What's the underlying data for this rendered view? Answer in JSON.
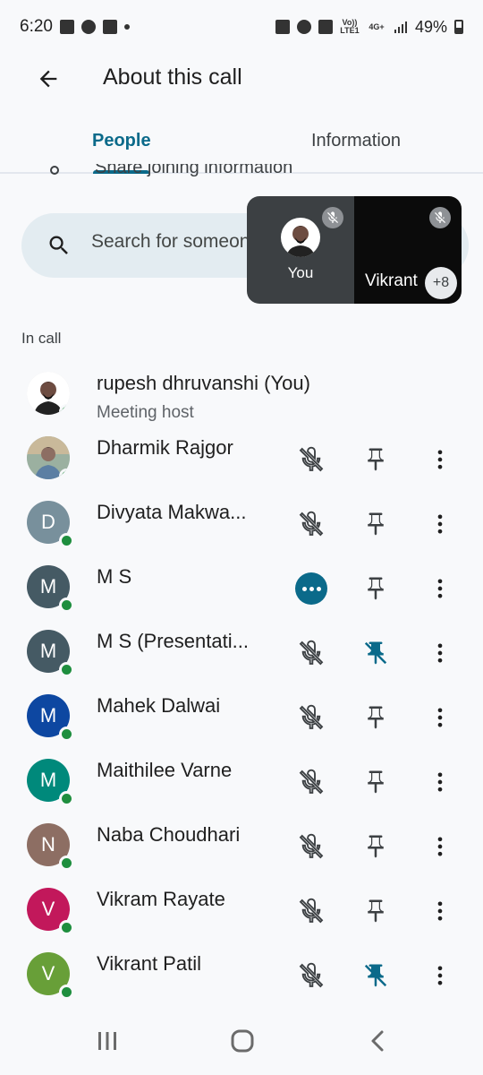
{
  "status_bar": {
    "time": "6:20",
    "battery": "49%",
    "left_icons": [
      "gallery-icon",
      "whatsapp-icon",
      "outlook-icon"
    ],
    "right_icons": [
      "screenshot-icon",
      "alarm-icon",
      "mute-icon",
      "volte-icon",
      "4g-icon",
      "signal-icon"
    ],
    "volte_label": "Vo)) LTE1",
    "network_label": "4G+"
  },
  "app_bar": {
    "title": "About this call"
  },
  "tabs": [
    {
      "label": "People",
      "active": true
    },
    {
      "label": "Information",
      "active": false
    }
  ],
  "partial_row": {
    "text": "Share joining information"
  },
  "search": {
    "placeholder": "Search for someone"
  },
  "video_tile": {
    "self_label": "You",
    "other_label": "Vikrant",
    "more_count": "+8"
  },
  "section": {
    "in_call_label": "In call"
  },
  "participants": [
    {
      "name": "rupesh dhruvanshi (You)",
      "subtitle": "Meeting host",
      "initial": "",
      "avatar_color": "",
      "photo": true,
      "mic": "none",
      "pin": "none"
    },
    {
      "name": "Dharmik Rajgor",
      "initial": "",
      "avatar_color": "",
      "photo": true,
      "mic": "muted",
      "pin": "normal"
    },
    {
      "name": "Divyata Makwa...",
      "initial": "D",
      "avatar_color": "#78909c",
      "photo": false,
      "mic": "muted",
      "pin": "normal"
    },
    {
      "name": "M S",
      "initial": "M",
      "avatar_color": "#455a64",
      "photo": false,
      "mic": "speaking",
      "pin": "normal"
    },
    {
      "name": "M S (Presentati...",
      "initial": "M",
      "avatar_color": "#455a64",
      "photo": false,
      "mic": "muted",
      "pin": "pinned"
    },
    {
      "name": "Mahek Dalwai",
      "initial": "M",
      "avatar_color": "#0d47a1",
      "photo": false,
      "mic": "muted",
      "pin": "normal"
    },
    {
      "name": "Maithilee Varne",
      "initial": "M",
      "avatar_color": "#00897b",
      "photo": false,
      "mic": "muted",
      "pin": "normal"
    },
    {
      "name": "Naba Choudhari",
      "initial": "N",
      "avatar_color": "#8d6e63",
      "photo": false,
      "mic": "muted",
      "pin": "normal"
    },
    {
      "name": "Vikram Rayate",
      "initial": "V",
      "avatar_color": "#c2185b",
      "photo": false,
      "mic": "muted",
      "pin": "normal"
    },
    {
      "name": "Vikrant Patil",
      "initial": "V",
      "avatar_color": "#689f38",
      "photo": false,
      "mic": "muted",
      "pin": "pinned"
    }
  ],
  "colors": {
    "accent": "#0b6a8a",
    "online": "#1e8e3e",
    "search_bg": "#e3ecf1"
  },
  "nav_bar": {
    "icons": [
      "recent-apps-icon",
      "home-icon",
      "back-icon"
    ]
  }
}
